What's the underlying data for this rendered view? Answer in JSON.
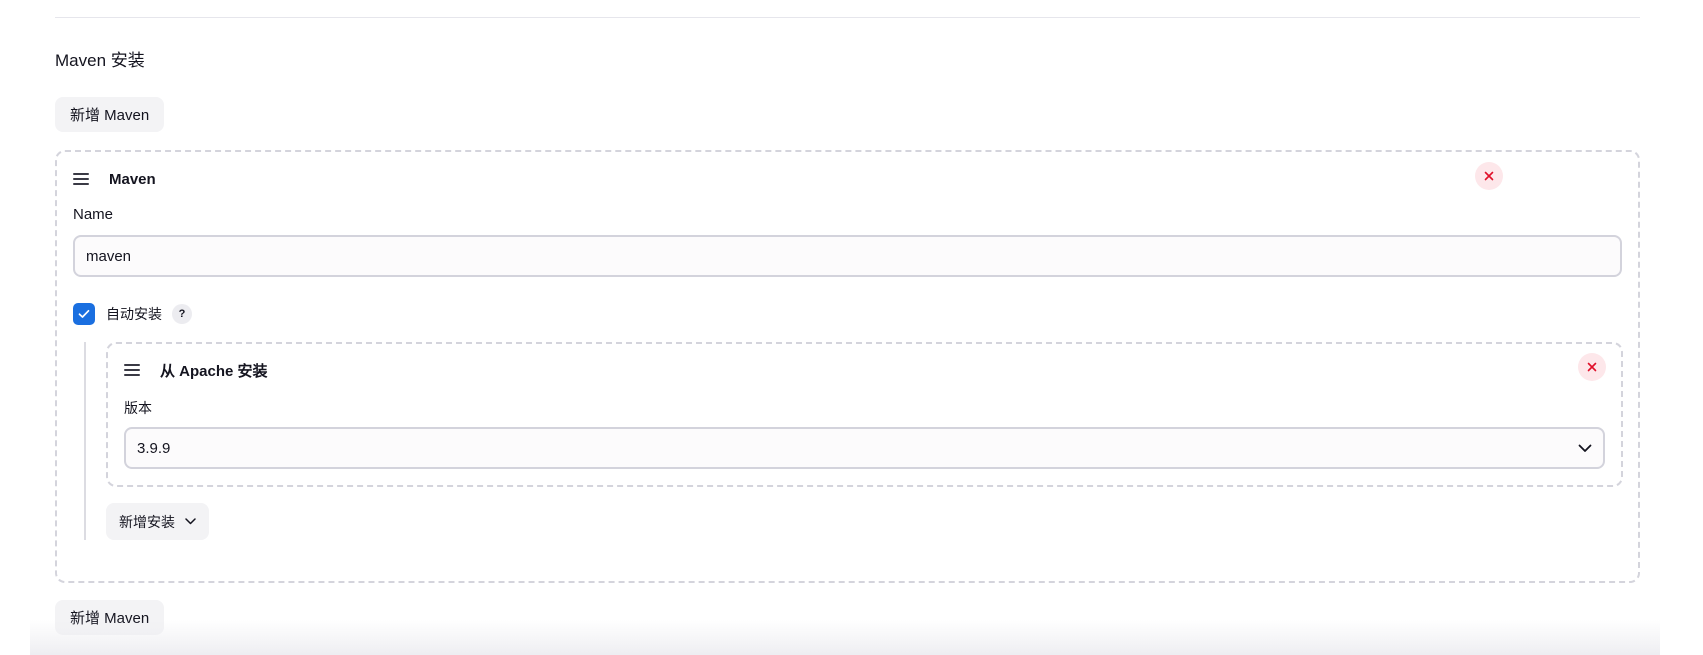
{
  "section": {
    "title": "Maven 安装",
    "add_button_label": "新增 Maven"
  },
  "maven_chunk": {
    "title": "Maven",
    "name_label": "Name",
    "name_value": "maven",
    "auto_install": {
      "label": "自动安装",
      "checked": true,
      "help_glyph": "?"
    },
    "installer": {
      "title": "从 Apache 安装",
      "version_label": "版本",
      "version_value": "3.9.9"
    },
    "add_installer_label": "新增安装"
  },
  "footer": {
    "add_button_label": "新增 Maven"
  },
  "colors": {
    "accent": "#1a6fe0",
    "danger": "#e0102a",
    "danger_bg": "#fde7ea",
    "button_bg": "#f3f3f5",
    "border": "#d4d4dc"
  },
  "icons": {
    "drag": "drag-handle-icon",
    "close": "close-icon",
    "check": "check-icon",
    "help": "help-icon",
    "chevron": "chevron-down-icon"
  }
}
